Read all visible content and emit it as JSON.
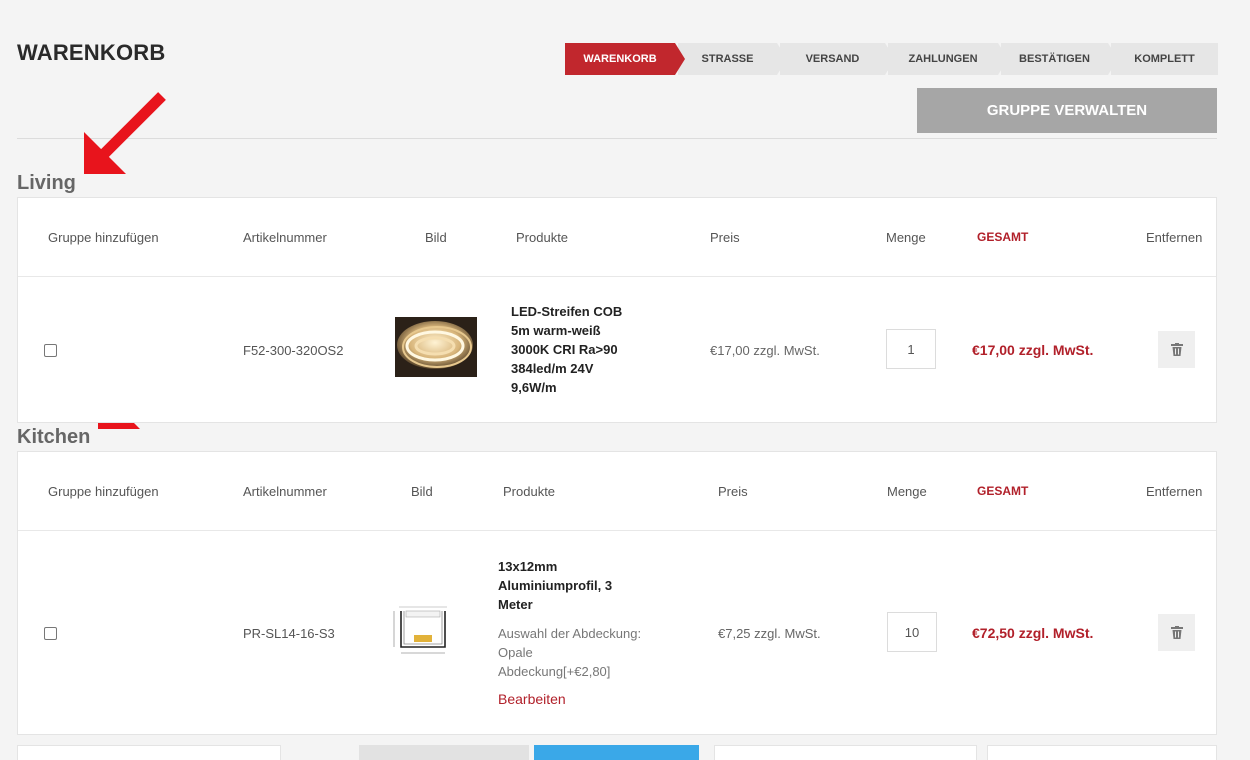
{
  "page": {
    "title": "WARENKORB"
  },
  "steps": [
    {
      "label": "WARENKORB",
      "active": true
    },
    {
      "label": "STRASSE",
      "active": false
    },
    {
      "label": "VERSAND",
      "active": false
    },
    {
      "label": "ZAHLUNGEN",
      "active": false
    },
    {
      "label": "BESTÄTIGEN",
      "active": false
    },
    {
      "label": "KOMPLETT",
      "active": false
    }
  ],
  "manage_group_button": "GRUPPE VERWALTEN",
  "columns": {
    "add_group": "Gruppe hinzufügen",
    "sku": "Artikelnummer",
    "image": "Bild",
    "product": "Produkte",
    "price": "Preis",
    "qty": "Menge",
    "total": "GESAMT",
    "remove": "Entfernen"
  },
  "groups": [
    {
      "name": "Living",
      "item": {
        "sku": "F52-300-320OS2",
        "name_lines": [
          "LED-Streifen COB",
          "5m warm-weiß",
          "3000K CRI Ra>90",
          "384led/m 24V",
          "9,6W/m"
        ],
        "price": "€17,00 zzgl. MwSt.",
        "qty": "1",
        "total": "€17,00 zzgl. MwSt."
      }
    },
    {
      "name": "Kitchen",
      "item": {
        "sku": "PR-SL14-16-S3",
        "name_lines": [
          "13x12mm",
          "Aluminiumprofil, 3",
          "Meter"
        ],
        "option_lines": [
          "Auswahl der Abdeckung:",
          "Opale",
          "Abdeckung[+€2,80]"
        ],
        "edit": "Bearbeiten",
        "price": "€7,25 zzgl. MwSt.",
        "qty": "10",
        "total": "€72,50 zzgl. MwSt."
      }
    }
  ],
  "colors": {
    "accent": "#c1272d",
    "button_gray": "#a6a6a6",
    "arrow": "#e8141c"
  },
  "icons": [
    "red-arrow-icon",
    "trash-icon",
    "led-strip-image",
    "aluminium-profile-image"
  ]
}
